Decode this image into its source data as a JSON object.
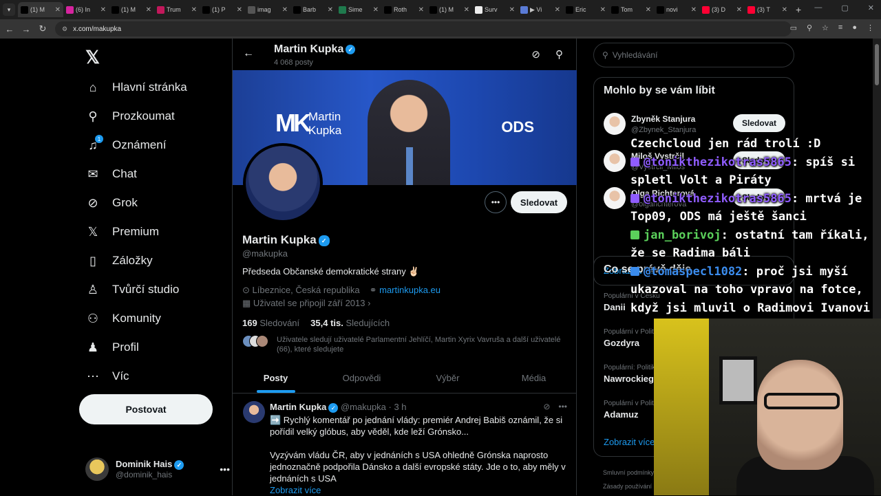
{
  "browser": {
    "tabs": [
      {
        "title": "(1) M",
        "icon": "x-icon",
        "color": "#000000",
        "active": true
      },
      {
        "title": "(6) In",
        "icon": "instagram-icon",
        "color": "#d6249f"
      },
      {
        "title": "(1) M",
        "icon": "x-icon",
        "color": "#000000"
      },
      {
        "title": "Trum",
        "icon": "linkedin-icon",
        "color": "#c2185b"
      },
      {
        "title": "(1) P",
        "icon": "x-icon",
        "color": "#000000"
      },
      {
        "title": "imag",
        "icon": "globe-icon",
        "color": "#555555"
      },
      {
        "title": "Barb",
        "icon": "x-icon",
        "color": "#000000"
      },
      {
        "title": "Sime",
        "icon": "x-icon",
        "color": "#1f7a4d"
      },
      {
        "title": "Roth",
        "icon": "x-icon",
        "color": "#000000"
      },
      {
        "title": "(1) M",
        "icon": "x-icon",
        "color": "#000000"
      },
      {
        "title": "Surv",
        "icon": "circle-icon",
        "color": "#eeeeee"
      },
      {
        "title": "▶ Vi",
        "icon": "video-icon",
        "color": "#5a7bd6"
      },
      {
        "title": "Eric",
        "icon": "x-icon",
        "color": "#000000"
      },
      {
        "title": "Tom",
        "icon": "x-icon",
        "color": "#000000"
      },
      {
        "title": "novi",
        "icon": "x-icon",
        "color": "#000000"
      },
      {
        "title": "(3) D",
        "icon": "youtube-icon",
        "color": "#ff0033"
      },
      {
        "title": "(3) T",
        "icon": "youtube-icon",
        "color": "#ff0033"
      }
    ],
    "url": "x.com/makupka"
  },
  "nav": {
    "items": [
      {
        "label": "Hlavní stránka",
        "icon": "home-icon",
        "glyph": "⌂"
      },
      {
        "label": "Prozkoumat",
        "icon": "search-icon",
        "glyph": "⚲"
      },
      {
        "label": "Oznámení",
        "icon": "bell-icon",
        "glyph": "♫",
        "badge": "1"
      },
      {
        "label": "Chat",
        "icon": "mail-icon",
        "glyph": "✉"
      },
      {
        "label": "Grok",
        "icon": "grok-icon",
        "glyph": "⊘"
      },
      {
        "label": "Premium",
        "icon": "x-logo-icon",
        "glyph": "𝕏"
      },
      {
        "label": "Záložky",
        "icon": "bookmark-icon",
        "glyph": "▯"
      },
      {
        "label": "Tvůrčí studio",
        "icon": "studio-icon",
        "glyph": "♙"
      },
      {
        "label": "Komunity",
        "icon": "communities-icon",
        "glyph": "⚇"
      },
      {
        "label": "Profil",
        "icon": "profile-icon",
        "glyph": "♟"
      },
      {
        "label": "Víc",
        "icon": "more-icon",
        "glyph": "⋯"
      }
    ],
    "post_label": "Postovat",
    "account": {
      "name": "Dominik Hais",
      "handle": "@dominik_hais"
    }
  },
  "profile": {
    "header_name": "Martin Kupka",
    "post_count": "4 068 posty",
    "banner": {
      "logo": "MK",
      "name_line1": "Martin",
      "name_line2": "Kupka",
      "party": "ODS"
    },
    "name": "Martin Kupka",
    "handle": "@makupka",
    "bio": "Předseda Občanské demokratické strany ✌🏻",
    "location": "Líbeznice, Česká republika",
    "website": "martinkupka.eu",
    "joined": "Uživatel se připojil září 2013",
    "following_count": "169",
    "following_label": "Sledování",
    "followers_count": "35,4 tis.",
    "followers_label": "Sledujících",
    "known_followers": "Uživatele sledují uživatelé Parlamentní Jehlíčí, Martin Xyrix Vavruša a další uživatelé (66), které sledujete",
    "follow_label": "Sledovat"
  },
  "tabs": [
    "Posty",
    "Odpovědi",
    "Výběr",
    "Média"
  ],
  "tweet": {
    "name": "Martin Kupka",
    "handle": "@makupka · 3 h",
    "para1": "➡️ Rychlý komentář po jednání vlády: premiér Andrej Babiš oznámil, že si pořídil velký glóbus, aby věděl, kde leží Grónsko...",
    "para2": "Vyzývám vládu ČR, aby v jednáních s USA ohledně Grónska naprosto jednoznačně podpořila Dánsko a další evropské státy. Jde o to, aby měly v jednáních s USA",
    "more": "Zobrazit více"
  },
  "right": {
    "search_placeholder": "Vyhledávání",
    "suggest_title": "Mohlo by se vám líbit",
    "suggestions": [
      {
        "name": "Zbyněk Stanjura",
        "handle": "@Zbynek_Stanjura",
        "btn": "Sledovat"
      },
      {
        "name": "Miloš Vystrčil",
        "handle": "@Vystrcil_Milos",
        "btn": "Sledovat"
      },
      {
        "name": "Olga Richterová",
        "handle": "@olgarichterova",
        "btn": "Sledovat"
      }
    ],
    "show_more": "Zobrazit více",
    "trends_title": "Co se právě děje",
    "trends": [
      {
        "cat": "Populární v Česku",
        "topic": "Danii"
      },
      {
        "cat": "Populární v Politice",
        "topic": "Gozdyra"
      },
      {
        "cat": "Populární: Politika",
        "topic": "Nawrockiego"
      },
      {
        "cat": "Populární v Politice",
        "topic": "Adamuz"
      }
    ],
    "trends_more": "Zobrazit více",
    "footer1": "Smluvní podmínky",
    "footer2": "Zásady používání"
  },
  "overlay_chat": {
    "line0": "Czechcloud jen rád trolí :D",
    "m1_user": "@tonikthezikotras5865",
    "m1_text": ": spíš si spletl Volt a Piráty",
    "m2_user": "@tonikthezikotras5865",
    "m2_text": ": mrtvá je Top09, ODS má ještě šanci",
    "m3_user": "jan_borivoj",
    "m3_text": ": ostatní tam říkali, že se Radima báli",
    "m4_user": "@tomaspecl1082",
    "m4_text": ": proč jsi myší ukazoval na toho vpravo na fotce, když jsi mluvil o Radimovi Ivanovi"
  }
}
